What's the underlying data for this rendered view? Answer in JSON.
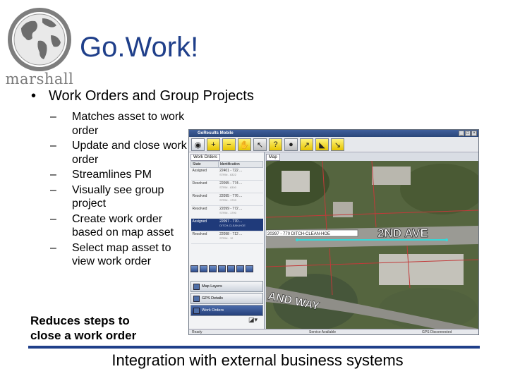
{
  "logo": {
    "wordmark": "marshall"
  },
  "slide": {
    "title": "Go.Work!",
    "main_bullet": "Work Orders and Group Projects",
    "sub_bullets": [
      "Matches asset to work order",
      "Update and close work order",
      "Streamlines PM",
      "Visually see group project",
      "Create work order based on map asset",
      "Select map asset to view work order"
    ],
    "reduce_line1": "Reduces steps to",
    "reduce_line2": "close a work order",
    "footer": "Integration with external business systems"
  },
  "app": {
    "title": "GoResults Mobile",
    "left_tab": "Work Orders",
    "map_tab": "Map",
    "columns": [
      "State",
      "Identification"
    ],
    "rows": [
      {
        "state": "Assigned",
        "id": "22401 - 722 ...",
        "sub": "STRM - 6322"
      },
      {
        "state": "Resolved",
        "id": "22095 - 774 ...",
        "sub": "STRM - 6300"
      },
      {
        "state": "Resolved",
        "id": "22095 - 776 ...",
        "sub": "STRM - 1703"
      },
      {
        "state": "Resolved",
        "id": "22099 - 772 ...",
        "sub": "STRM - 1790"
      },
      {
        "state": "Assigned",
        "id": "22097 - 770 ...",
        "sub": "DITCH-CLEAN-HOE"
      },
      {
        "state": "Resolved",
        "id": "22098 - 712 ...",
        "sub": "STRM - 12"
      }
    ],
    "selected_row": 4,
    "nav_buttons": [
      "Map Layers",
      "GPS Details",
      "Work Orders"
    ],
    "map_callout": "20397 - 770 DITCH-CLEAN-HOE",
    "street_label_1": "2ND AVE",
    "street_label_2": "AND WAY",
    "status_left": "Ready",
    "status_mid": "Service Available",
    "status_right": "GPS Disconnected"
  }
}
